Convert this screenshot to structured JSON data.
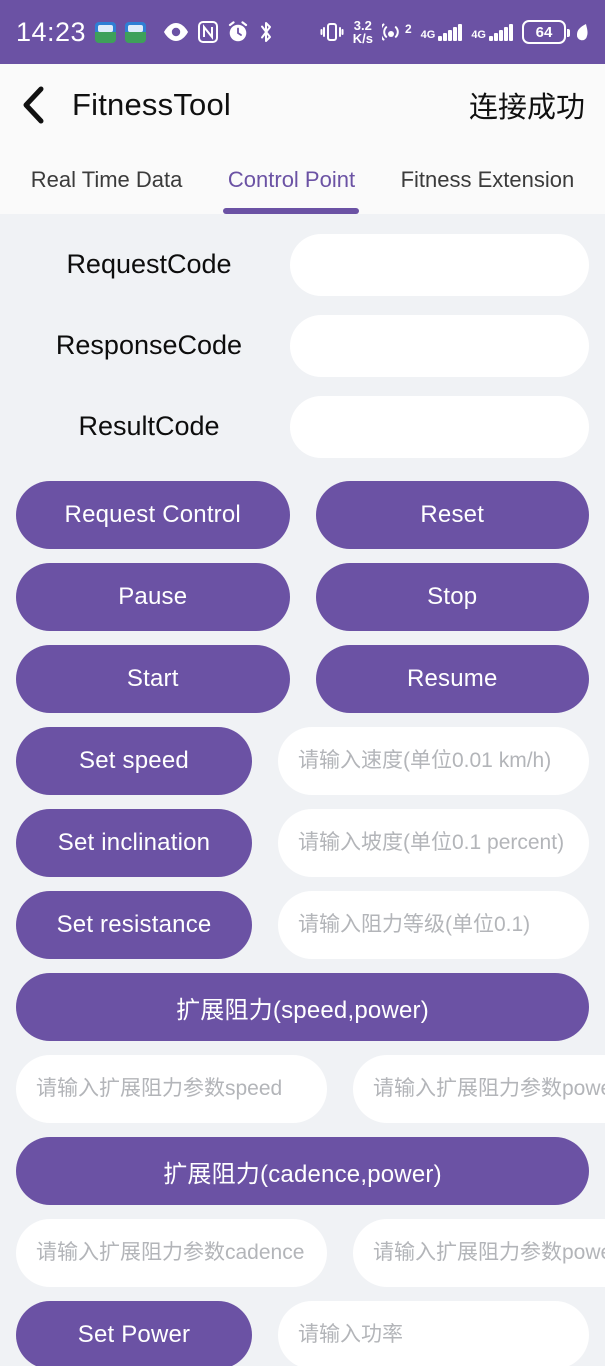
{
  "statusbar": {
    "time": "14:23",
    "network_speed_value": "3.2",
    "network_speed_unit": "K/s",
    "hotspot_badge": "2",
    "cell1_label": "4G",
    "cell2_label": "4G",
    "battery_level": "64",
    "icons": [
      "app-notification-icon",
      "app-notification-icon",
      "eye-icon",
      "nfc-icon",
      "alarm-icon",
      "bluetooth-icon",
      "vibrate-icon",
      "hotspot-icon",
      "signal-icon",
      "signal-icon",
      "battery-icon",
      "charging-leaf-icon"
    ]
  },
  "header": {
    "back_icon": "chevron-left-icon",
    "title": "FitnessTool",
    "connection_status": "连接成功"
  },
  "tabs": [
    {
      "label": "Real Time Data",
      "active": false
    },
    {
      "label": "Control Point",
      "active": true
    },
    {
      "label": "Fitness Extension",
      "active": false
    }
  ],
  "code_fields": [
    {
      "label": "RequestCode",
      "value": "",
      "placeholder": ""
    },
    {
      "label": "ResponseCode",
      "value": "",
      "placeholder": ""
    },
    {
      "label": "ResultCode",
      "value": "",
      "placeholder": ""
    }
  ],
  "button_rows": [
    {
      "left": "Request Control",
      "right": "Reset"
    },
    {
      "left": "Pause",
      "right": "Stop"
    },
    {
      "left": "Start",
      "right": "Resume"
    }
  ],
  "set_rows": [
    {
      "button": "Set speed",
      "placeholder": "请输入速度(单位0.01 km/h)",
      "value": ""
    },
    {
      "button": "Set inclination",
      "placeholder": "请输入坡度(单位0.1 percent)",
      "value": ""
    },
    {
      "button": "Set resistance",
      "placeholder": "请输入阻力等级(单位0.1)",
      "value": ""
    }
  ],
  "ext_speed_power": {
    "button": "扩展阻力(speed,power)",
    "input_a_placeholder": "请输入扩展阻力参数speed",
    "input_a_value": "",
    "input_b_placeholder": "请输入扩展阻力参数power",
    "input_b_value": ""
  },
  "ext_cadence_power": {
    "button": "扩展阻力(cadence,power)",
    "input_a_placeholder": "请输入扩展阻力参数cadence",
    "input_a_value": "",
    "input_b_placeholder": "请输入扩展阻力参数power",
    "input_b_value": ""
  },
  "set_power": {
    "button": "Set Power",
    "placeholder": "请输入功率",
    "value": ""
  },
  "colors": {
    "accent_purple": "#6b52a4",
    "page_background": "#f0f2f5",
    "header_background": "#fafafa",
    "field_white": "#ffffff",
    "placeholder_gray": "#b3b5b9"
  }
}
